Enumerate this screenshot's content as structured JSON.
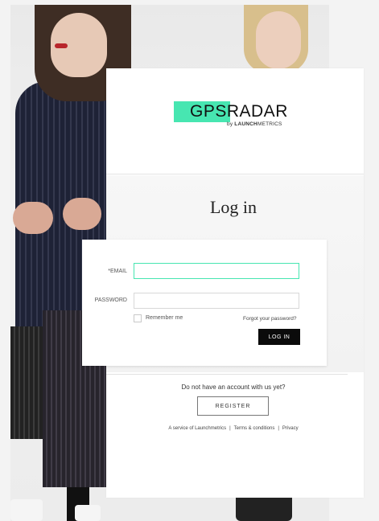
{
  "brand": {
    "logo_main": "GPSRADAR",
    "logo_sub_prefix": "by ",
    "logo_sub_bold": "LAUNCH",
    "logo_sub_rest": "METRICS",
    "accent_color": "#47e6b1"
  },
  "login": {
    "title": "Log in",
    "email_label": "*EMAIL",
    "email_value": "",
    "password_label": "PASSWORD",
    "password_value": "",
    "remember_label": "Remember me",
    "forgot_label": "Forgot your password?",
    "submit_label": "LOG IN"
  },
  "register": {
    "prompt": "Do not have an account with us yet?",
    "button_label": "REGISTER"
  },
  "footer": {
    "service": "A service of Launchmetrics",
    "sep1": "|",
    "terms": "Terms & conditions",
    "sep2": "|",
    "privacy": "Privacy"
  }
}
